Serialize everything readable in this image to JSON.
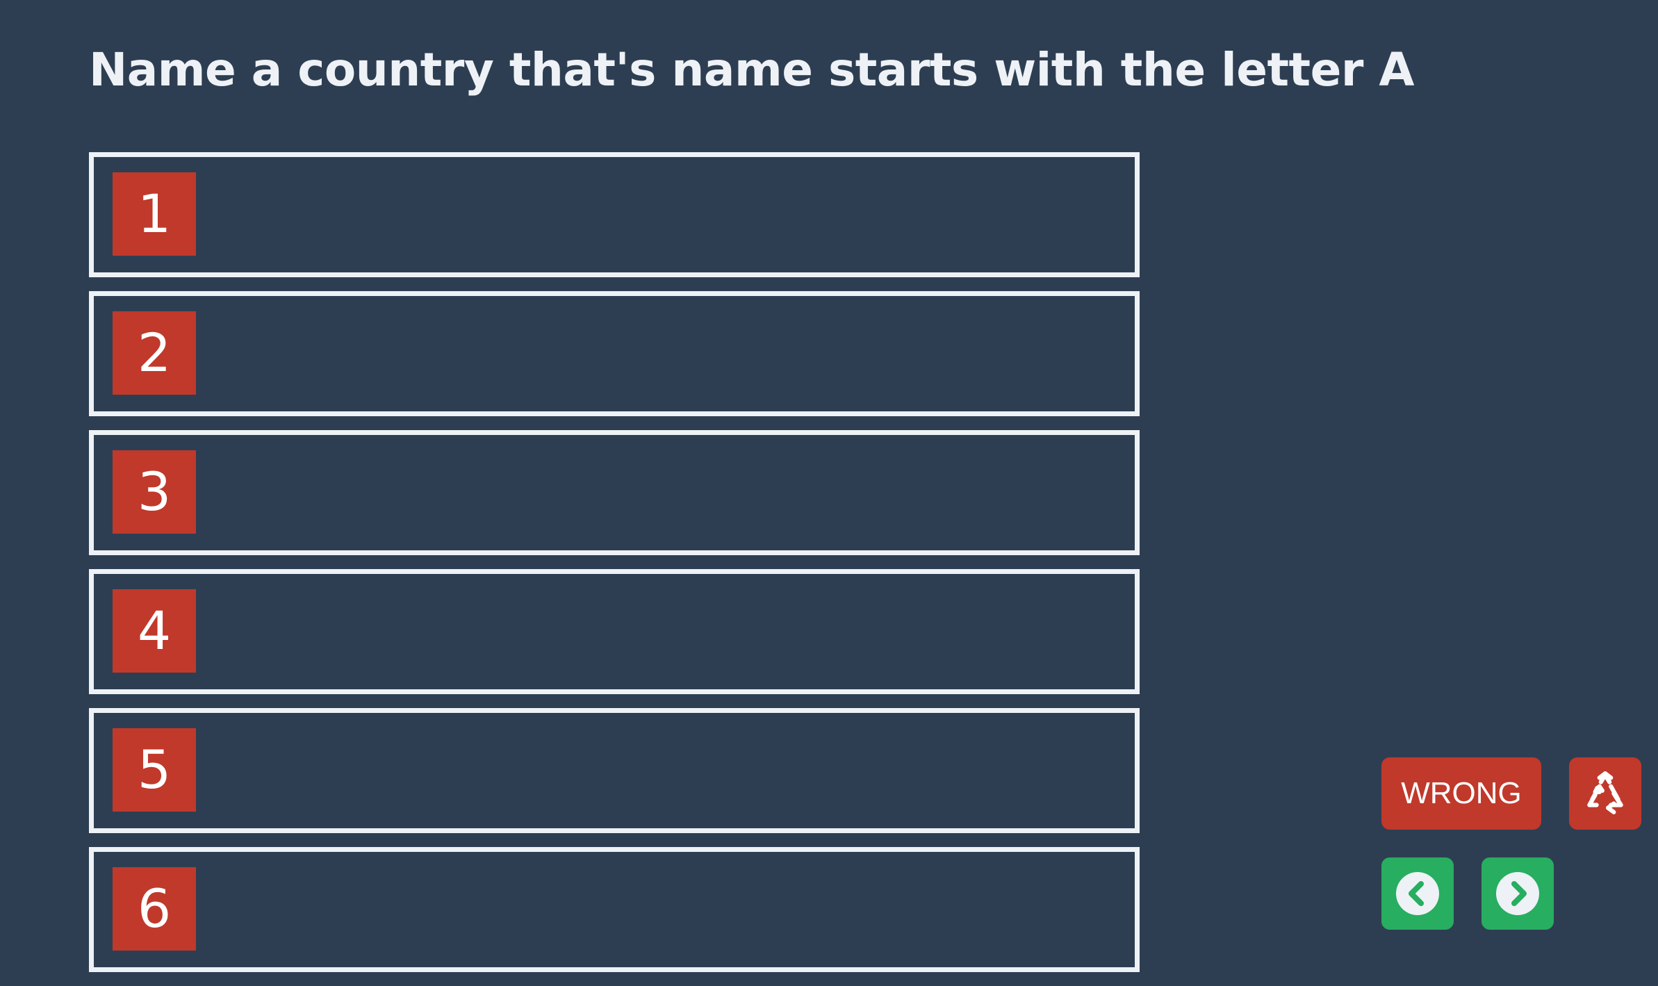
{
  "question": "Name a country that's name starts with the letter A",
  "answers": [
    {
      "number": "1",
      "text": ""
    },
    {
      "number": "2",
      "text": ""
    },
    {
      "number": "3",
      "text": ""
    },
    {
      "number": "4",
      "text": ""
    },
    {
      "number": "5",
      "text": ""
    },
    {
      "number": "6",
      "text": ""
    }
  ],
  "controls": {
    "wrong_label": "WRONG",
    "reset_icon": "recycle-icon",
    "prev_icon": "chevron-left-circle-icon",
    "next_icon": "chevron-right-circle-icon"
  },
  "colors": {
    "background": "#2e3e52",
    "text": "#eef2f6",
    "number_badge": "#c0392b",
    "wrong_button": "#c0392b",
    "nav_button": "#27ae60"
  }
}
